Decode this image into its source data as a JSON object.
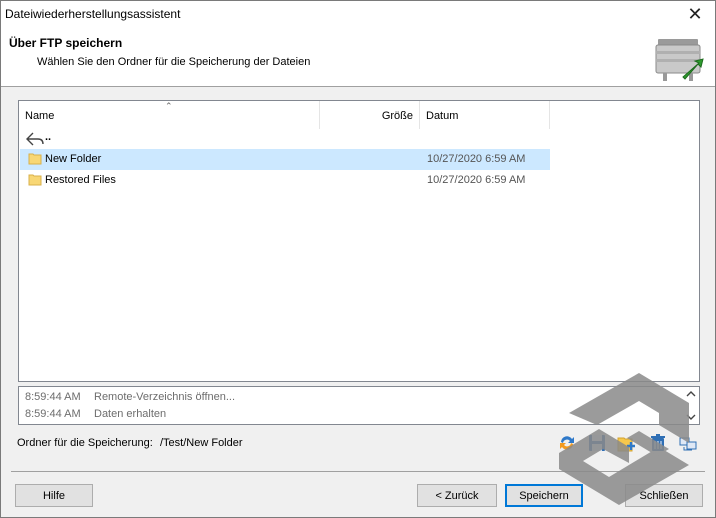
{
  "window": {
    "title": "Dateiwiederherstellungsassistent",
    "close_icon": "close-icon"
  },
  "header": {
    "title": "Über FTP speichern",
    "subtitle": "Wählen Sie den Ordner für die Speicherung der Dateien",
    "icon": "ftp-folder-icon"
  },
  "filelist": {
    "columns": {
      "name": "Name",
      "size": "Größe",
      "date": "Datum"
    },
    "parent": "..",
    "rows": [
      {
        "name": "New Folder",
        "date": "10/27/2020 6:59 AM"
      },
      {
        "name": "Restored Files",
        "date": "10/27/2020 6:59 AM"
      }
    ]
  },
  "log": {
    "lines": [
      {
        "time": "8:59:44 AM",
        "msg": "Remote-Verzeichnis öffnen..."
      },
      {
        "time": "8:59:44 AM",
        "msg": "Daten erhalten"
      }
    ]
  },
  "savepath": {
    "label": "Ordner für die Speicherung:",
    "value": "/Test/New Folder"
  },
  "toolbar": {
    "icons": [
      "refresh-icon",
      "save-icon",
      "new-folder-icon",
      "delete-icon",
      "connection-icon"
    ]
  },
  "buttons": {
    "help": "Hilfe",
    "back": "< Zurück",
    "save": "Speichern",
    "close": "Schließen"
  },
  "colors": {
    "selection": "#cce8ff",
    "accent": "#0078d7",
    "folder": "#f8d775"
  }
}
